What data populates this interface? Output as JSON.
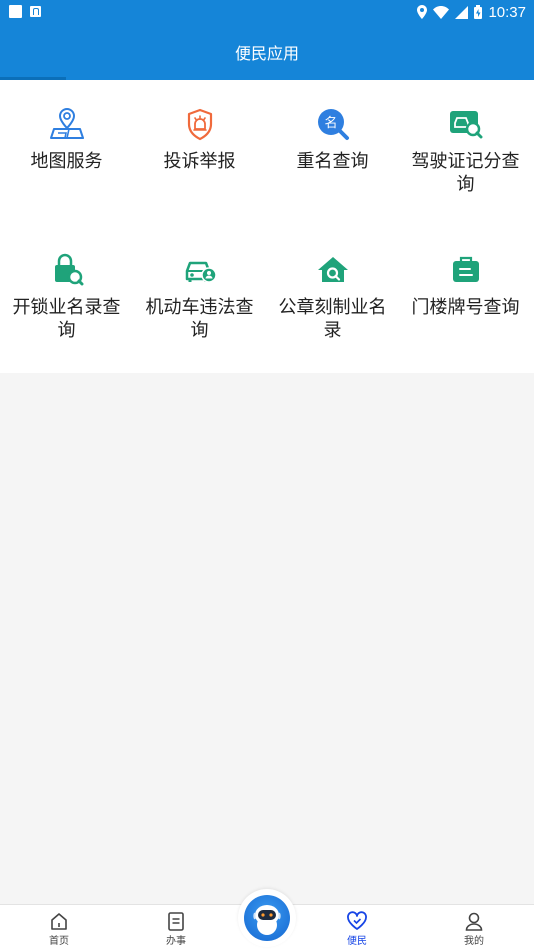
{
  "status_bar": {
    "time": "10:37"
  },
  "header": {
    "title": "便民应用"
  },
  "services": [
    {
      "label": "地图服务",
      "icon": "map-pin-icon",
      "color": "#2f7fe0"
    },
    {
      "label": "投诉举报",
      "icon": "siren-shield-icon",
      "color": "#f06a3c"
    },
    {
      "label": "重名查询",
      "icon": "name-search-icon",
      "color": "#2f7fe0"
    },
    {
      "label": "驾驶证记分查询",
      "icon": "license-search-icon",
      "color": "#1fa37a"
    },
    {
      "label": "开锁业名录查询",
      "icon": "lock-search-icon",
      "color": "#1fa37a"
    },
    {
      "label": "机动车违法查询",
      "icon": "car-violation-icon",
      "color": "#1fa37a"
    },
    {
      "label": "公章刻制业名录",
      "icon": "seal-house-search-icon",
      "color": "#1fa37a"
    },
    {
      "label": "门楼牌号查询",
      "icon": "doorplate-icon",
      "color": "#1fa37a"
    }
  ],
  "tabbar": {
    "items": [
      {
        "label": "首页",
        "icon": "home-icon",
        "active": false
      },
      {
        "label": "办事",
        "icon": "document-icon",
        "active": false
      },
      {
        "label": "便民",
        "icon": "heart-icon",
        "active": true
      },
      {
        "label": "我的",
        "icon": "user-icon",
        "active": false
      }
    ],
    "center_button": "robot-assistant-icon",
    "active_color": "#1745e6"
  }
}
